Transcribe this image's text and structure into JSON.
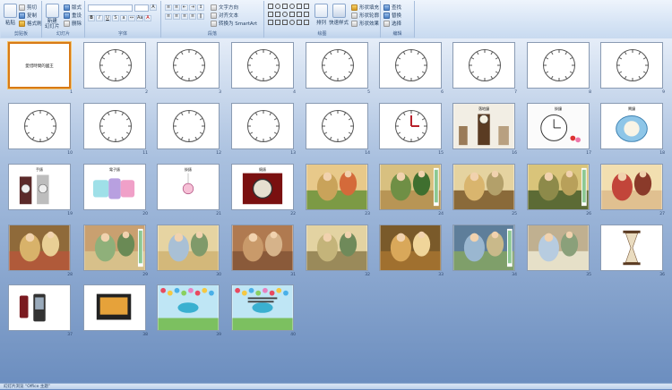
{
  "ribbon": {
    "clipboard": {
      "paste": "粘贴",
      "cut": "剪切",
      "copy": "复制",
      "format_painter": "格式刷",
      "label": "剪贴板"
    },
    "slides": {
      "new_slide": "新建\n幻灯片",
      "layout": "版式",
      "reset": "重设",
      "delete": "删除",
      "label": "幻灯片"
    },
    "font": {
      "label": "字体"
    },
    "paragraph": {
      "text_direction": "文字方向",
      "align_text": "对齐文本",
      "smartart": "转换为 SmartArt",
      "label": "段落"
    },
    "drawing": {
      "arrange": "排列",
      "quick_styles": "快速样式",
      "shape_fill": "形状填充",
      "shape_outline": "形状轮廓",
      "shape_effects": "形状效果",
      "label": "绘图"
    },
    "editing": {
      "find": "查找",
      "replace": "替换",
      "select": "选择",
      "label": "编辑"
    }
  },
  "title_slide_text": "愛惜時間的國王",
  "slides": [
    {
      "n": "1",
      "kind": "title"
    },
    {
      "n": "2",
      "kind": "clock"
    },
    {
      "n": "3",
      "kind": "clock"
    },
    {
      "n": "4",
      "kind": "clock"
    },
    {
      "n": "5",
      "kind": "clock"
    },
    {
      "n": "6",
      "kind": "clock"
    },
    {
      "n": "7",
      "kind": "clock"
    },
    {
      "n": "8",
      "kind": "clock"
    },
    {
      "n": "9",
      "kind": "clock"
    },
    {
      "n": "10",
      "kind": "clock"
    },
    {
      "n": "11",
      "kind": "clock"
    },
    {
      "n": "12",
      "kind": "clock"
    },
    {
      "n": "13",
      "kind": "clock"
    },
    {
      "n": "14",
      "kind": "clock-nums"
    },
    {
      "n": "15",
      "kind": "clock-red"
    },
    {
      "n": "16",
      "kind": "photo-grandfather"
    },
    {
      "n": "17",
      "kind": "photo-wallclock"
    },
    {
      "n": "18",
      "kind": "photo-alarm"
    },
    {
      "n": "19",
      "kind": "photo-watches"
    },
    {
      "n": "20",
      "kind": "photo-colorwatch"
    },
    {
      "n": "21",
      "kind": "photo-pendant"
    },
    {
      "n": "22",
      "kind": "photo-pocket"
    },
    {
      "n": "23",
      "kind": "illus-a"
    },
    {
      "n": "24",
      "kind": "illus-b"
    },
    {
      "n": "25",
      "kind": "illus-c"
    },
    {
      "n": "26",
      "kind": "illus-d"
    },
    {
      "n": "27",
      "kind": "illus-e"
    },
    {
      "n": "28",
      "kind": "illus-f"
    },
    {
      "n": "29",
      "kind": "illus-g"
    },
    {
      "n": "30",
      "kind": "illus-h"
    },
    {
      "n": "31",
      "kind": "illus-i"
    },
    {
      "n": "32",
      "kind": "illus-j"
    },
    {
      "n": "33",
      "kind": "illus-k"
    },
    {
      "n": "34",
      "kind": "illus-l"
    },
    {
      "n": "35",
      "kind": "illus-m"
    },
    {
      "n": "36",
      "kind": "photo-hourglass"
    },
    {
      "n": "37",
      "kind": "photo-phone"
    },
    {
      "n": "38",
      "kind": "photo-device"
    },
    {
      "n": "39",
      "kind": "thanks"
    },
    {
      "n": "40",
      "kind": "thanks2"
    }
  ],
  "captions": {
    "16": "落地鐘",
    "17": "掛鐘",
    "18": "鬧鐘",
    "19": "手錶",
    "20": "電子錶",
    "21": "掛錶",
    "22": "懷錶"
  },
  "status": "幻灯片浏览  “Office 主题”"
}
